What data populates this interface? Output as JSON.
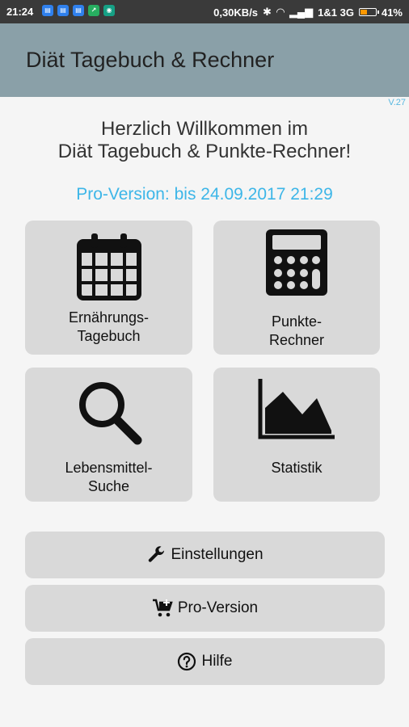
{
  "status_bar": {
    "time": "21:24",
    "network_speed": "0,30KB/s",
    "carrier": "1&1 3G",
    "battery": "41%",
    "battery_level": 0.41,
    "notification_icons": [
      "notification-icon",
      "notification-icon",
      "notification-icon",
      "notification-icon",
      "notification-icon"
    ]
  },
  "app_bar": {
    "title": "Diät Tagebuch & Rechner"
  },
  "version": "V.27",
  "welcome": {
    "line1": "Herzlich Willkommen im",
    "line2": "Diät Tagebuch & Punkte-Rechner!"
  },
  "pro_status": "Pro-Version: bis 24.09.2017 21:29",
  "tiles": {
    "diary": {
      "line1": "Ernährungs-",
      "line2": "Tagebuch",
      "icon": "calendar-icon"
    },
    "calculator": {
      "line1": "Punkte-",
      "line2": "Rechner",
      "icon": "calculator-icon"
    },
    "search": {
      "line1": "Lebensmittel-",
      "line2": "Suche",
      "icon": "search-icon"
    },
    "statistics": {
      "line1": "Statistik",
      "icon": "area-chart-icon"
    }
  },
  "buttons": {
    "settings": {
      "label": "Einstellungen",
      "icon": "wrench-icon"
    },
    "pro_version": {
      "label": "Pro-Version",
      "icon": "cart-icon"
    },
    "help": {
      "label": "Hilfe",
      "icon": "help-icon"
    }
  },
  "colors": {
    "app_bar": "#8aa0a8",
    "accent": "#3db6e8",
    "tile": "#d9d9d9",
    "status_bar": "#3a3a3a"
  }
}
